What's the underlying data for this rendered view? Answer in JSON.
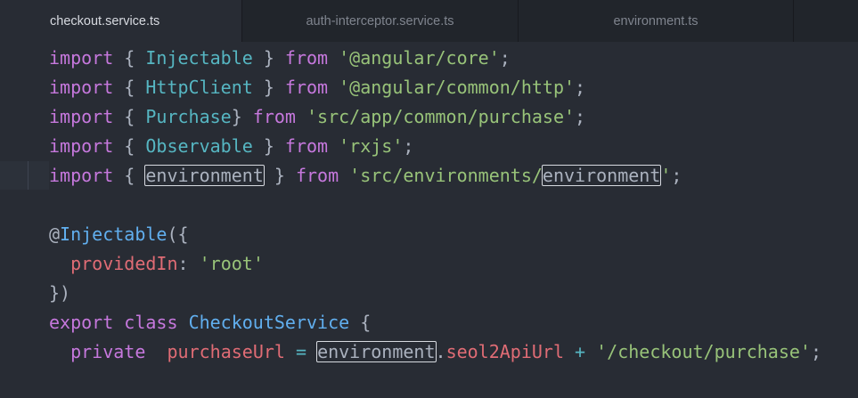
{
  "tabs": [
    {
      "label": "checkout.service.ts",
      "active": true
    },
    {
      "label": "auth-interceptor.service.ts",
      "active": false
    },
    {
      "label": "environment.ts",
      "active": false
    }
  ],
  "code": {
    "l1": {
      "kw1": "import",
      "p1": " { ",
      "id": "Injectable",
      "p2": " } ",
      "kw2": "from",
      "sp": " ",
      "str": "'@angular/core'",
      "end": ";"
    },
    "l2": {
      "kw1": "import",
      "p1": " { ",
      "id": "HttpClient",
      "p2": " } ",
      "kw2": "from",
      "sp": " ",
      "str": "'@angular/common/http'",
      "end": ";"
    },
    "l3": {
      "kw1": "import",
      "p1": " { ",
      "id": "Purchase",
      "p2": "} ",
      "kw2": "from",
      "sp": " ",
      "str": "'src/app/common/purchase'",
      "end": ";"
    },
    "l4": {
      "kw1": "import",
      "p1": " { ",
      "id": "Observable",
      "p2": " } ",
      "kw2": "from",
      "sp": " ",
      "str": "'rxjs'",
      "end": ";"
    },
    "l5": {
      "kw1": "import",
      "p1": " { ",
      "id": "environment",
      "p2": " } ",
      "kw2": "from",
      "sp": " ",
      "str_a": "'src/environments/",
      "str_hl": "environment",
      "str_b": "'",
      "end": ";"
    },
    "l7": {
      "at": "@",
      "dec": "Injectable",
      "rest": "({"
    },
    "l8": {
      "indent": "  ",
      "prop": "providedIn",
      "colon": ": ",
      "str": "'root'"
    },
    "l9": {
      "text": "})"
    },
    "l10": {
      "kw1": "export",
      "sp1": " ",
      "kw2": "class",
      "sp2": " ",
      "cls": "CheckoutService",
      "rest": " {"
    },
    "l11": {
      "indent": "  ",
      "kw": "private",
      "sp": "  ",
      "prop": "purchaseUrl",
      "eq": " = ",
      "env": "environment",
      "dot": ".",
      "member": "seol2ApiUrl",
      "plus": " + ",
      "str": "'/checkout/purchase'",
      "end": ";"
    }
  }
}
